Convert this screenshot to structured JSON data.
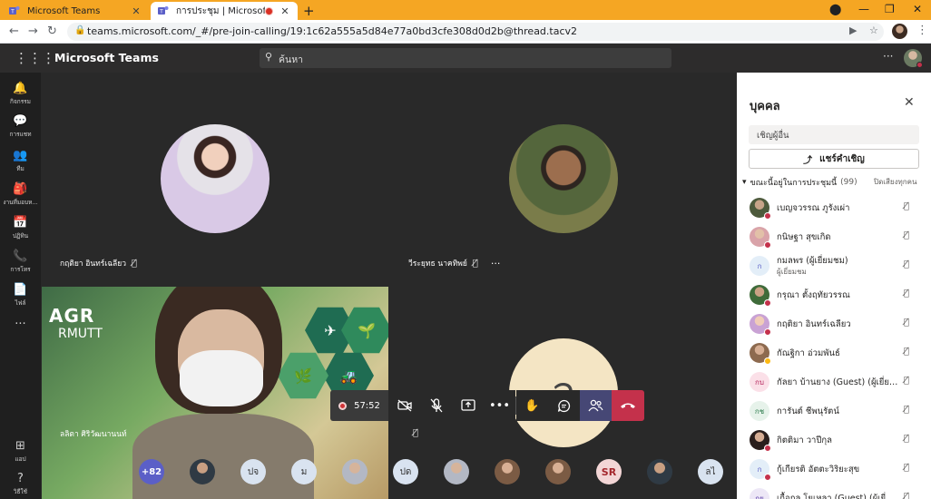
{
  "browser": {
    "tabs": [
      {
        "title": "Microsoft Teams",
        "close": "✕"
      },
      {
        "title": "การประชุม | Microsoft Teams",
        "close": "✕"
      }
    ],
    "new_tab": "+",
    "url": "teams.microsoft.com/_#/pre-join-calling/19:1c62a555a5d84e77a0bd3cfe308d0d2b@thread.tacv2"
  },
  "app": {
    "title": "Microsoft Teams",
    "search_placeholder": "ค้นหา"
  },
  "rail": [
    {
      "label": "กิจกรรม",
      "icon": "bell-icon",
      "glyph": "🔔"
    },
    {
      "label": "การแชท",
      "icon": "chat-icon",
      "glyph": "💬"
    },
    {
      "label": "ทีม",
      "icon": "teams-icon",
      "glyph": "👥"
    },
    {
      "label": "งานที่มอบห...",
      "icon": "assignments-icon",
      "glyph": "🎒"
    },
    {
      "label": "ปฏิทิน",
      "icon": "calendar-icon",
      "glyph": "📅"
    },
    {
      "label": "การโทร",
      "icon": "phone-icon",
      "glyph": "📞"
    },
    {
      "label": "ไฟล์",
      "icon": "file-icon",
      "glyph": "📄"
    },
    {
      "label": "",
      "icon": "more-icon",
      "glyph": "···"
    },
    {
      "label": "แอป",
      "icon": "apps-icon",
      "glyph": "⊞"
    },
    {
      "label": "วิธีใช้",
      "icon": "help-icon",
      "glyph": "?"
    }
  ],
  "stage": {
    "tiles": [
      {
        "name": "กฤติยา อินทร์เฉลียว"
      },
      {
        "name": "วีระยุทธ นาคทิพย์"
      },
      {
        "name": "ลลิตา ศิริวัฒนานนท์",
        "logo_top": "AGR",
        "logo_bottom": "RMUTT"
      },
      {
        "initial": "ล"
      }
    ]
  },
  "controls": {
    "timer": "57:52"
  },
  "strip": {
    "overflow": "+82",
    "initials": [
      "ปจ",
      "ม",
      "ปด",
      "SR",
      "ลไ"
    ]
  },
  "panel": {
    "title": "บุคคล",
    "invite_placeholder": "เชิญผู้อื่น",
    "share_label": "แชร์คำเชิญ",
    "section_label": "ขณะนี้อยู่ในการประชุมนี้",
    "count": "(99)",
    "mute_all": "ปิดเสียงทุกคน",
    "participants": [
      {
        "name": "เบญจวรรณ ภูรังเผ่า",
        "initials": ""
      },
      {
        "name": "กนิษฐา สุขเกิด",
        "initials": ""
      },
      {
        "name": "กมลพร (ผู้เยี่ยมชม)",
        "sub": "ผู้เยี่ยมชม",
        "initials": "ก"
      },
      {
        "name": "กรุณา ตั้งฤทัยวรรณ",
        "initials": ""
      },
      {
        "name": "กฤติยา อินทร์เฉลียว",
        "initials": ""
      },
      {
        "name": "กัณฐิกา อ่วมพันธ์",
        "initials": ""
      },
      {
        "name": "กัลยา บ้านยาง (Guest) (ผู้เยี่ยม...",
        "initials": "กบ"
      },
      {
        "name": "การันต์ ชีพนุรัตน์",
        "initials": "กช"
      },
      {
        "name": "กิตติมา วาปีกุล",
        "initials": ""
      },
      {
        "name": "กู้เกียรติ อัตตะวิริยะสุข",
        "initials": "ก"
      },
      {
        "name": "เกื้อกูล โยเหลา (Guest) (ผู้เยี่ยม...",
        "initials": "กย"
      }
    ]
  },
  "colors": {
    "tab_strip": "#f5a623",
    "teams_header": "#2d2c2c",
    "stage": "#292929",
    "accent": "#5b5fc7",
    "hangup": "#c4314b"
  }
}
